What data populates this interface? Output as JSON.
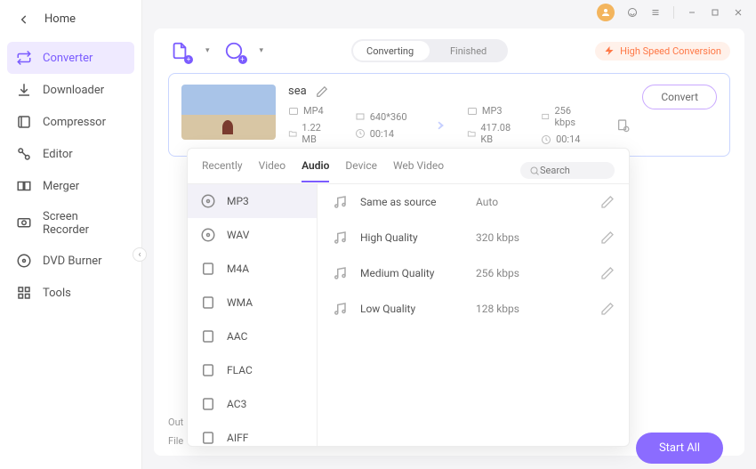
{
  "window_controls": {
    "avatar_initial": ""
  },
  "home": {
    "label": "Home"
  },
  "sidebar": {
    "items": [
      {
        "label": "Converter"
      },
      {
        "label": "Downloader"
      },
      {
        "label": "Compressor"
      },
      {
        "label": "Editor"
      },
      {
        "label": "Merger"
      },
      {
        "label": "Screen Recorder"
      },
      {
        "label": "DVD Burner"
      },
      {
        "label": "Tools"
      }
    ]
  },
  "segmented": {
    "converting": "Converting",
    "finished": "Finished"
  },
  "high_speed": "High Speed Conversion",
  "task": {
    "title": "sea",
    "src_format": "MP4",
    "src_res": "640*360",
    "src_size": "1.22 MB",
    "src_dur": "00:14",
    "dst_format": "MP3",
    "dst_bitrate": "256 kbps",
    "dst_size": "417.08 KB",
    "dst_dur": "00:14",
    "convert_label": "Convert"
  },
  "popover": {
    "tabs": {
      "recently": "Recently",
      "video": "Video",
      "audio": "Audio",
      "device": "Device",
      "web": "Web Video"
    },
    "search_placeholder": "Search",
    "formats": [
      {
        "label": "MP3"
      },
      {
        "label": "WAV"
      },
      {
        "label": "M4A"
      },
      {
        "label": "WMA"
      },
      {
        "label": "AAC"
      },
      {
        "label": "FLAC"
      },
      {
        "label": "AC3"
      },
      {
        "label": "AIFF"
      }
    ],
    "presets": [
      {
        "name": "Same as source",
        "bitrate": "Auto"
      },
      {
        "name": "High Quality",
        "bitrate": "320 kbps"
      },
      {
        "name": "Medium Quality",
        "bitrate": "256 kbps"
      },
      {
        "name": "Low Quality",
        "bitrate": "128 kbps"
      }
    ]
  },
  "footer": {
    "output": "Out",
    "file": "File",
    "start_all": "Start All"
  }
}
